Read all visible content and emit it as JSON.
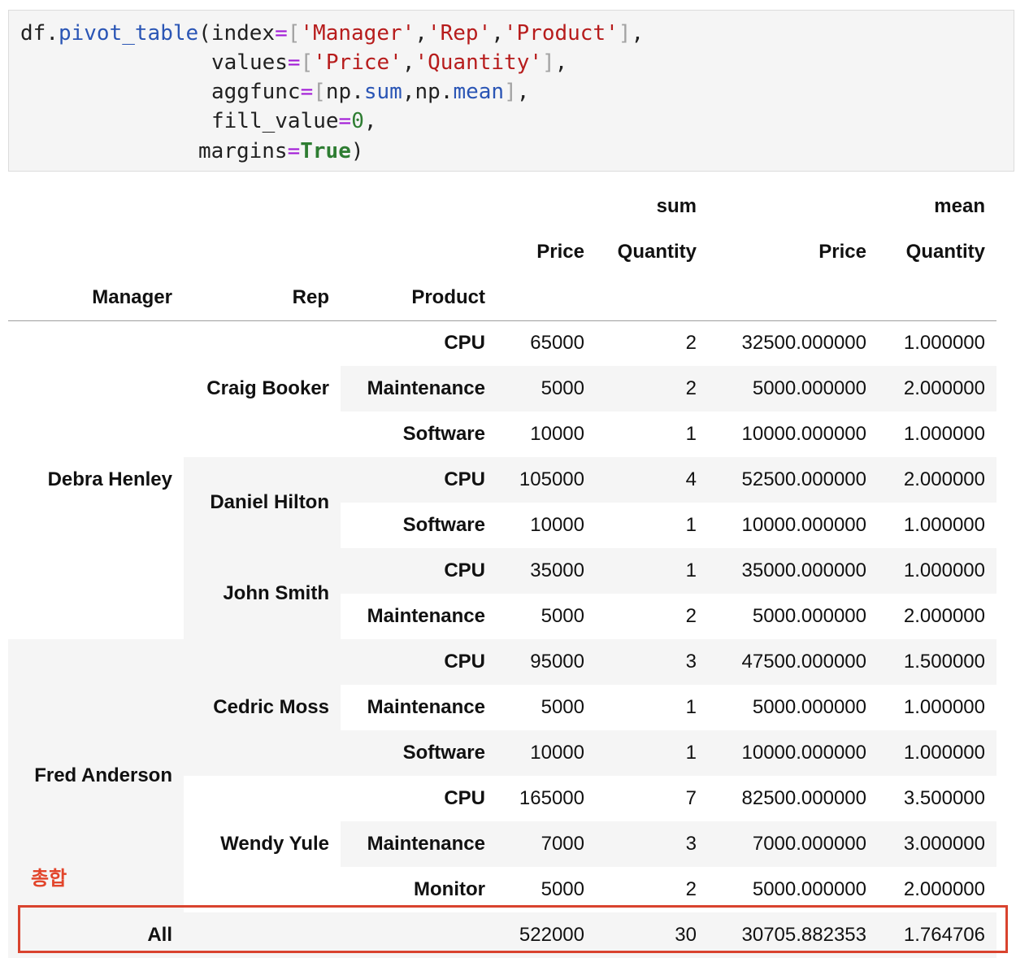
{
  "code": {
    "line1": {
      "obj": "df",
      "dot": ".",
      "fn": "pivot_table",
      "open": "(",
      "kw": "index",
      "eq": "=",
      "lb": "[",
      "s1": "'Manager'",
      "c1": ",",
      "s2": "'Rep'",
      "c2": ",",
      "s3": "'Product'",
      "rb": "]",
      "end": ","
    },
    "line2": {
      "kw": "values",
      "eq": "=",
      "lb": "[",
      "s1": "'Price'",
      "c1": ",",
      "s2": "'Quantity'",
      "rb": "]",
      "end": ","
    },
    "line3": {
      "kw": "aggfunc",
      "eq": "=",
      "lb": "[",
      "m1": "np",
      "d1": ".",
      "f1": "sum",
      "c1": ",",
      "m2": "np",
      "d2": ".",
      "f2": "mean",
      "rb": "]",
      "end": ","
    },
    "line4": {
      "kw": "fill_value",
      "eq": "=",
      "num": "0",
      "end": ","
    },
    "line5": {
      "kw": "margins",
      "eq": "=",
      "val": "True",
      "close": ")"
    }
  },
  "table": {
    "column_groups": [
      "sum",
      "mean"
    ],
    "value_columns": [
      "Price",
      "Quantity",
      "Price",
      "Quantity"
    ],
    "index_names": [
      "Manager",
      "Rep",
      "Product"
    ],
    "rows": [
      {
        "manager": "Debra Henley",
        "rep": "Craig Booker",
        "product": "CPU",
        "values": [
          "65000",
          "2",
          "32500.000000",
          "1.000000"
        ]
      },
      {
        "manager": "",
        "rep": "",
        "product": "Maintenance",
        "values": [
          "5000",
          "2",
          "5000.000000",
          "2.000000"
        ]
      },
      {
        "manager": "",
        "rep": "",
        "product": "Software",
        "values": [
          "10000",
          "1",
          "10000.000000",
          "1.000000"
        ]
      },
      {
        "manager": "",
        "rep": "Daniel Hilton",
        "product": "CPU",
        "values": [
          "105000",
          "4",
          "52500.000000",
          "2.000000"
        ]
      },
      {
        "manager": "",
        "rep": "",
        "product": "Software",
        "values": [
          "10000",
          "1",
          "10000.000000",
          "1.000000"
        ]
      },
      {
        "manager": "",
        "rep": "John Smith",
        "product": "CPU",
        "values": [
          "35000",
          "1",
          "35000.000000",
          "1.000000"
        ]
      },
      {
        "manager": "",
        "rep": "",
        "product": "Maintenance",
        "values": [
          "5000",
          "2",
          "5000.000000",
          "2.000000"
        ]
      },
      {
        "manager": "Fred Anderson",
        "rep": "Cedric Moss",
        "product": "CPU",
        "values": [
          "95000",
          "3",
          "47500.000000",
          "1.500000"
        ]
      },
      {
        "manager": "",
        "rep": "",
        "product": "Maintenance",
        "values": [
          "5000",
          "1",
          "5000.000000",
          "1.000000"
        ]
      },
      {
        "manager": "",
        "rep": "",
        "product": "Software",
        "values": [
          "10000",
          "1",
          "10000.000000",
          "1.000000"
        ]
      },
      {
        "manager": "",
        "rep": "Wendy Yule",
        "product": "CPU",
        "values": [
          "165000",
          "7",
          "82500.000000",
          "3.500000"
        ]
      },
      {
        "manager": "",
        "rep": "",
        "product": "Maintenance",
        "values": [
          "7000",
          "3",
          "7000.000000",
          "3.000000"
        ]
      },
      {
        "manager": "",
        "rep": "",
        "product": "Monitor",
        "values": [
          "5000",
          "2",
          "5000.000000",
          "2.000000"
        ]
      }
    ],
    "total_row": {
      "label": "All",
      "values": [
        "522000",
        "30",
        "30705.882353",
        "1.764706"
      ]
    }
  },
  "annotation": {
    "label": "총합",
    "color": "#e2452b"
  },
  "colors": {
    "row_stripe": "#f5f5f5",
    "code_bg": "#f5f5f5",
    "highlight_box": "#d9432e"
  }
}
